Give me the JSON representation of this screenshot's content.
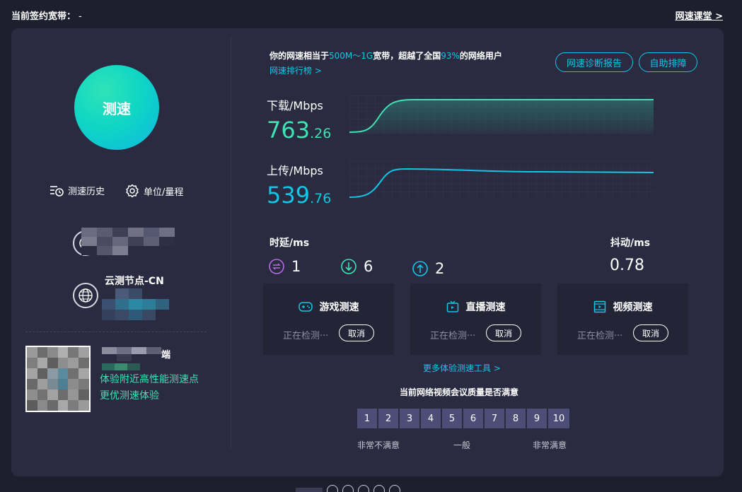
{
  "topbar": {
    "bandwidth_label": "当前签约宽带：",
    "bandwidth_value": "-",
    "course_link": "网速课堂 >"
  },
  "left": {
    "speed_button": "测速",
    "history_label": "测速历史",
    "unit_label": "单位/量程",
    "node_title": "云测节点-CN",
    "promo_tail": "端",
    "promo_line1": "体验附近高性能测速点",
    "promo_line2": "更优测速体验"
  },
  "summary": {
    "prefix": "你的网速相当于",
    "range": "500M～1G",
    "middle": "宽带，超越了全国",
    "percent": "93%",
    "suffix": "的网络用户",
    "rank_link": "网速排行榜 >",
    "diag_button": "网速诊断报告",
    "self_button": "自助排障"
  },
  "download": {
    "label": "下载/Mbps",
    "int": "763",
    "dec": ".26",
    "color": "#3ee2b4"
  },
  "upload": {
    "label": "上传/Mbps",
    "int": "539",
    "dec": ".76",
    "color": "#12c6e6"
  },
  "latency": {
    "label": "时延/ms",
    "idle": "1",
    "down": "6",
    "up": "2",
    "jitter_label": "抖动/ms",
    "jitter": "0.78"
  },
  "cards": [
    {
      "title": "游戏测速",
      "status": "正在检测···",
      "cancel": "取消"
    },
    {
      "title": "直播测速",
      "status": "正在检测···",
      "cancel": "取消"
    },
    {
      "title": "视频测速",
      "status": "正在检测···",
      "cancel": "取消"
    }
  ],
  "more_tools": "更多体验测速工具 >",
  "survey": {
    "question": "当前网络视频会议质量是否满意",
    "scale": [
      "1",
      "2",
      "3",
      "4",
      "5",
      "6",
      "7",
      "8",
      "9",
      "10"
    ],
    "low": "非常不满意",
    "mid": "一般",
    "high": "非常满意"
  }
}
